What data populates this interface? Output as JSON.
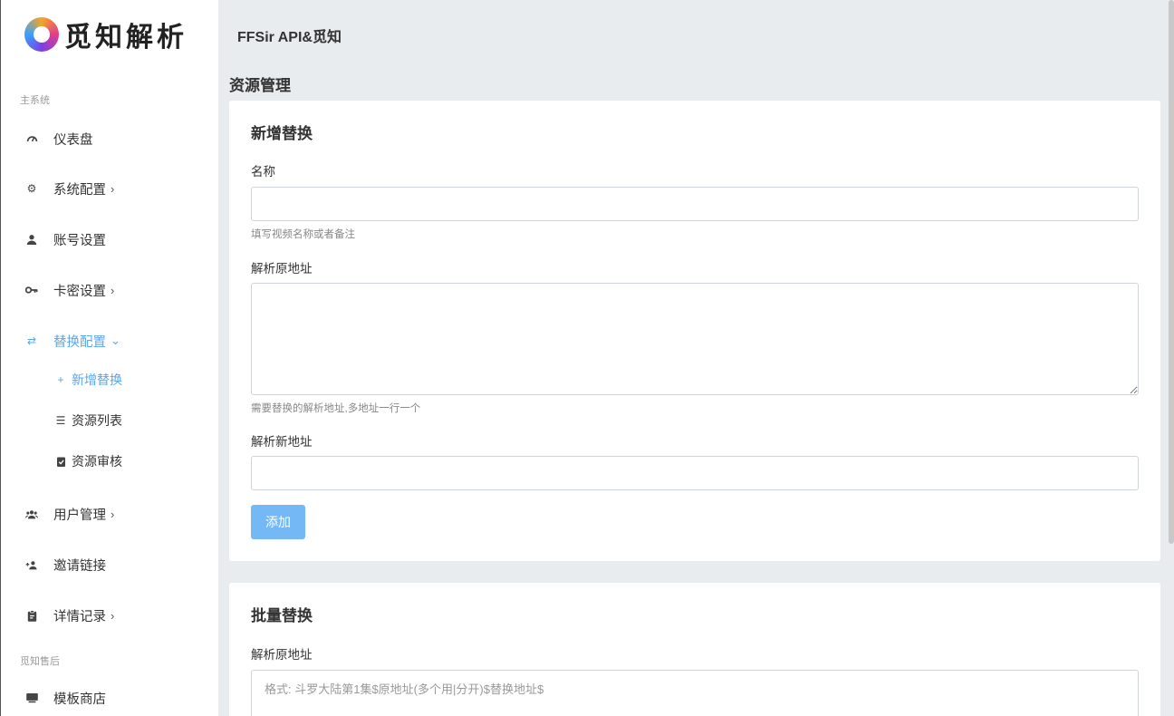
{
  "brand": {
    "logo_text": "觅知解析"
  },
  "header": {
    "title": "FFSir API&觅知"
  },
  "sidebar": {
    "section_main": "主系统",
    "items": [
      {
        "label": "仪表盘",
        "icon": "dashboard-icon"
      },
      {
        "label": "系统配置",
        "icon": "gear-icon",
        "has_children": true
      },
      {
        "label": "账号设置",
        "icon": "user-icon"
      },
      {
        "label": "卡密设置",
        "icon": "key-icon",
        "has_children": true
      },
      {
        "label": "替换配置",
        "icon": "swap-icon",
        "has_children": true,
        "expanded": true,
        "children": [
          {
            "label": "新增替换",
            "icon": "plus-icon",
            "active": true
          },
          {
            "label": "资源列表",
            "icon": "list-icon"
          },
          {
            "label": "资源审核",
            "icon": "clipboard-check-icon"
          }
        ]
      },
      {
        "label": "用户管理",
        "icon": "users-icon",
        "has_children": true
      },
      {
        "label": "邀请链接",
        "icon": "user-plus-icon"
      },
      {
        "label": "详情记录",
        "icon": "clipboard-icon",
        "has_children": true
      }
    ],
    "section_after": "觅知售后",
    "after_items": [
      {
        "label": "模板商店",
        "icon": "store-icon"
      }
    ]
  },
  "main": {
    "page_title": "资源管理",
    "add_card": {
      "title": "新增替换",
      "name_label": "名称",
      "name_value": "",
      "name_help": "填写视频名称或者备注",
      "orig_label": "解析原地址",
      "orig_value": "",
      "orig_help": "需要替换的解析地址,多地址一行一个",
      "new_label": "解析新地址",
      "new_value": "",
      "submit_label": "添加"
    },
    "batch_card": {
      "title": "批量替换",
      "orig_label": "解析原地址",
      "orig_placeholder": "格式: 斗罗大陆第1集$原地址(多个用|分开)$替换地址$"
    }
  },
  "colors": {
    "accent": "#57a7ef",
    "button": "#74b8f5"
  }
}
